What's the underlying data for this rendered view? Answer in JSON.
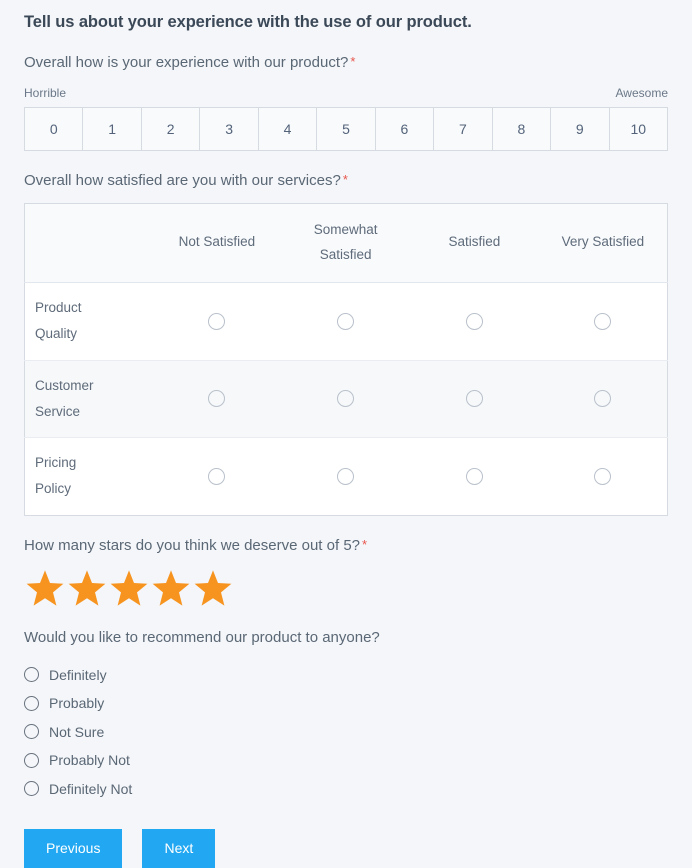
{
  "survey": {
    "title": "Tell us about your experience with the use of our product.",
    "required_marker": "*"
  },
  "nps_question": {
    "label": "Overall how is your experience with our product?",
    "required": true,
    "low_label": "Horrible",
    "high_label": "Awesome",
    "options": [
      "0",
      "1",
      "2",
      "3",
      "4",
      "5",
      "6",
      "7",
      "8",
      "9",
      "10"
    ],
    "selected": null
  },
  "matrix_question": {
    "label": "Overall how satisfied are you with our services?",
    "required": true,
    "columns": [
      "Not Satisfied",
      "Somewhat Satisfied",
      "Satisfied",
      "Very Satisfied"
    ],
    "rows": [
      {
        "label": "Product Quality",
        "selected": null
      },
      {
        "label": "Customer Service",
        "selected": null
      },
      {
        "label": "Pricing Policy",
        "selected": null
      }
    ]
  },
  "star_question": {
    "label": "How many stars do you think we deserve out of 5?",
    "required": true,
    "max": 5,
    "filled": 5,
    "star_color": "#f79420",
    "stars": [
      "star-1",
      "star-2",
      "star-3",
      "star-4",
      "star-5"
    ]
  },
  "recommend_question": {
    "label": "Would you like to recommend our product to anyone?",
    "required": false,
    "options": [
      "Definitely",
      "Probably",
      "Not Sure",
      "Probably Not",
      "Definitely Not"
    ],
    "selected": null
  },
  "navigation": {
    "previous_label": "Previous",
    "next_label": "Next",
    "button_color": "#22a8f2"
  }
}
